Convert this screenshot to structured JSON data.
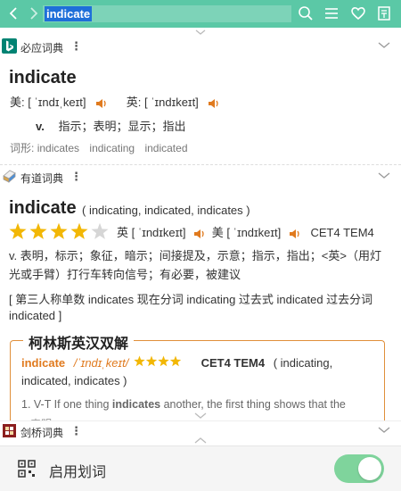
{
  "search": {
    "query": "indicate"
  },
  "colors": {
    "accent": "#5bc8a6",
    "speaker": "#e07a1e",
    "star": "#f2b705",
    "toggle_on": "#7fd49c"
  },
  "bing": {
    "name": "必应词典",
    "more": "⋮",
    "word": "indicate",
    "us_label": "美:",
    "us_phon": "[ ˈɪndɪˌkeɪt]",
    "uk_label": "英:",
    "uk_phon": "[ ˈɪndɪkeɪt]",
    "pos": "v.",
    "def": "指示；表明；显示；指出",
    "forms_label": "词形:",
    "forms": [
      "indicates",
      "indicating",
      "indicated"
    ]
  },
  "youdao": {
    "name": "有道词典",
    "more": "⋮",
    "word": "indicate",
    "inflections": "( indicating, indicated, indicates )",
    "rating": 4,
    "rating_max": 5,
    "uk_label": "英",
    "uk_phon": "[ ˈɪndɪkeɪt]",
    "us_label": "美",
    "us_phon": "[ ˈɪndɪkeɪt]",
    "tags": "CET4 TEM4",
    "def_line1": "v. 表明，标示；象征，暗示；间接提及，示意；指示，指出；<英>（用灯",
    "def_line2": "光或手臂）打行车转向信号；有必要，被建议",
    "forms_line1": "[ 第三人称单数 indicates 现在分词 indicating 过去式 indicated 过去分词",
    "forms_line2": "indicated ]"
  },
  "collins": {
    "title": "柯林斯英汉双解",
    "word": "indicate",
    "phon": "/ˈɪndɪˌkeɪt/",
    "rating": 4,
    "tags": "CET4 TEM4",
    "inflect_line1": "( indicating,",
    "inflect_line2": "indicated, indicates )",
    "def_prefix": "1. V-T If one thing ",
    "def_bold": "indicates",
    "def_suffix": " another, the first thing shows that the",
    "def_partial": "                             ...表明"
  },
  "cambridge": {
    "name": "剑桥词典",
    "more": "⋮"
  },
  "bottom": {
    "enable_label": "启用划词",
    "toggle_on": true
  }
}
